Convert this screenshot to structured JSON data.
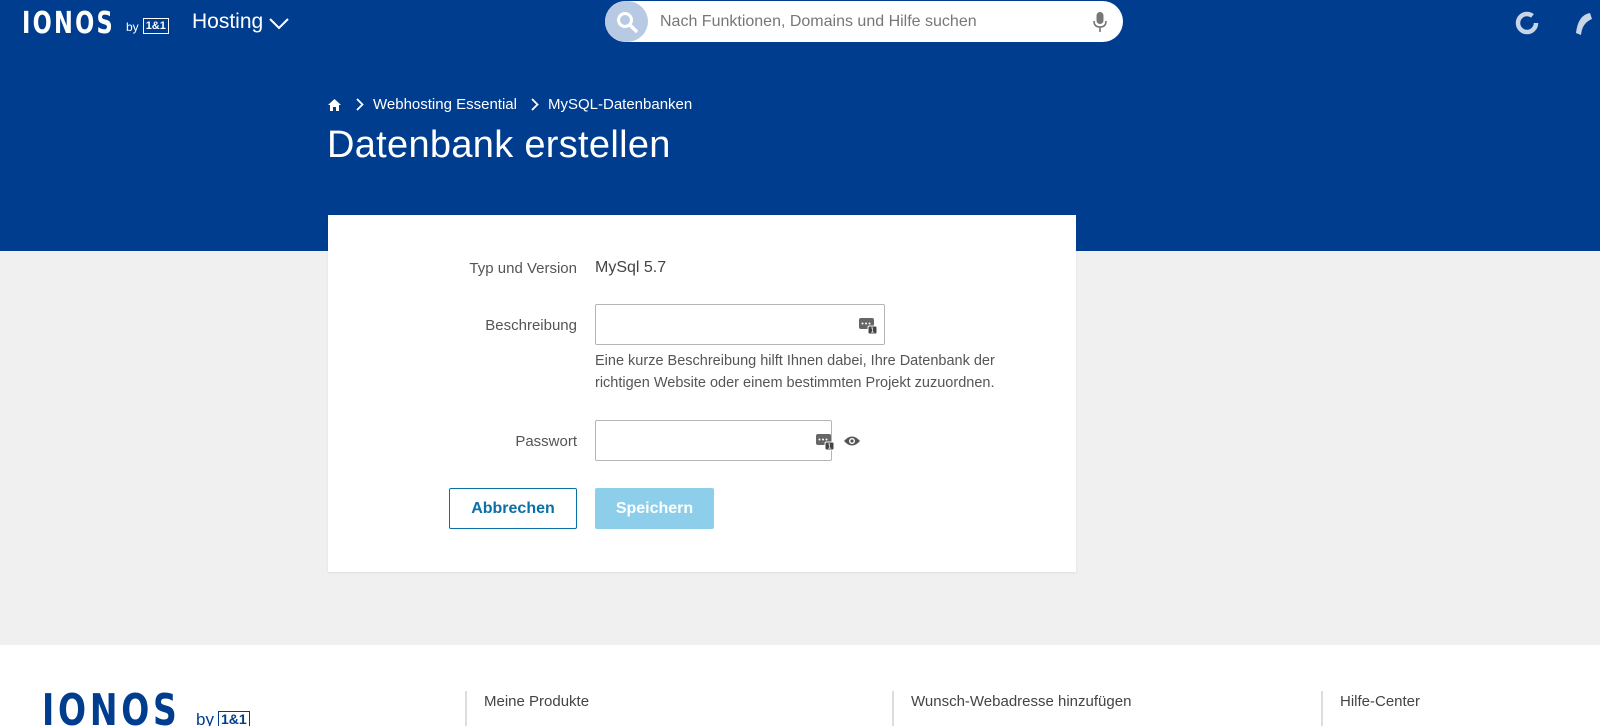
{
  "topbar": {
    "logo_text": "IONOS",
    "logo_by": "by",
    "logo_brand": "1&1",
    "product_menu": "Hosting",
    "search_placeholder": "Nach Funktionen, Domains und Hilfe suchen",
    "icons": [
      "search-icon",
      "microphone-icon",
      "refresh-icon",
      "phone-icon"
    ]
  },
  "breadcrumb": {
    "home_icon": "home-icon",
    "items": [
      "Webhosting Essential",
      "MySQL-Datenbanken"
    ]
  },
  "page_title": "Datenbank erstellen",
  "form": {
    "type_label": "Typ und Version",
    "type_value": "MySql 5.7",
    "description_label": "Beschreibung",
    "description_value": "",
    "description_help": "Eine kurze Beschreibung hilft Ihnen dabei, Ihre Datenbank der richtigen Website oder einem bestimmten Projekt zuzuordnen.",
    "password_label": "Passwort",
    "password_value": "",
    "cancel_label": "Abbrechen",
    "save_label": "Speichern"
  },
  "footer": {
    "logo_text": "IONOS",
    "logo_by": "by",
    "logo_brand": "1&1",
    "links": [
      "Meine Produkte",
      "Wunsch-Webadresse hinzufügen",
      "Hilfe-Center"
    ]
  },
  "colors": {
    "brand_blue": "#003d8f",
    "save_button_disabled": "#8dcfea",
    "cancel_border": "#0b6fa8",
    "background": "#f0f0f0"
  }
}
